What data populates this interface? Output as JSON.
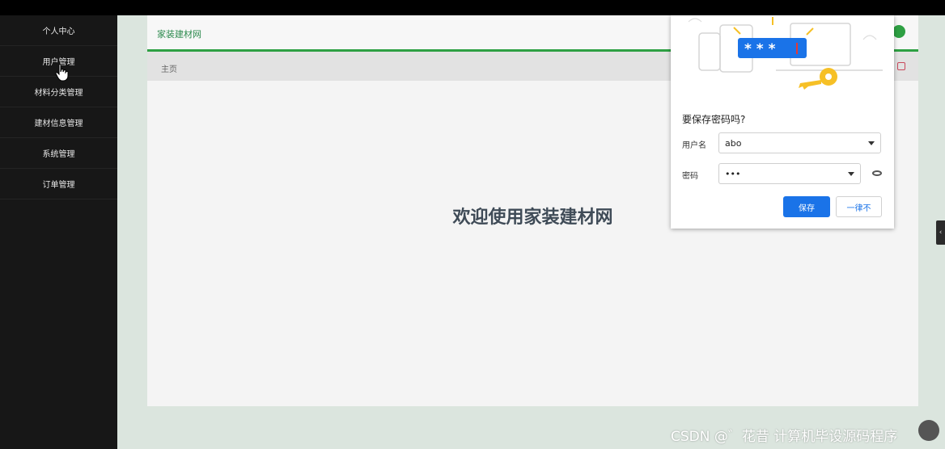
{
  "sidebar": {
    "items": [
      {
        "label": "个人中心"
      },
      {
        "label": "用户管理"
      },
      {
        "label": "材料分类管理"
      },
      {
        "label": "建材信息管理"
      },
      {
        "label": "系统管理"
      },
      {
        "label": "订单管理"
      }
    ]
  },
  "header": {
    "brand": "家装建材网"
  },
  "breadcrumb": {
    "home": "主页"
  },
  "main": {
    "welcome": "欢迎使用家装建材网"
  },
  "password_popup": {
    "illustration_text": "* * *",
    "title": "要保存密码吗?",
    "username_label": "用户名",
    "username_value": "abo",
    "password_label": "密码",
    "password_value": "•••",
    "save_label": "保存",
    "never_label": "一律不"
  },
  "watermark": {
    "text": "CSDN @゛花昔 计算机毕设源码程序"
  },
  "colors": {
    "accent": "#2ea043",
    "sidebar_bg": "#171717",
    "primary_button": "#1a73e8"
  }
}
